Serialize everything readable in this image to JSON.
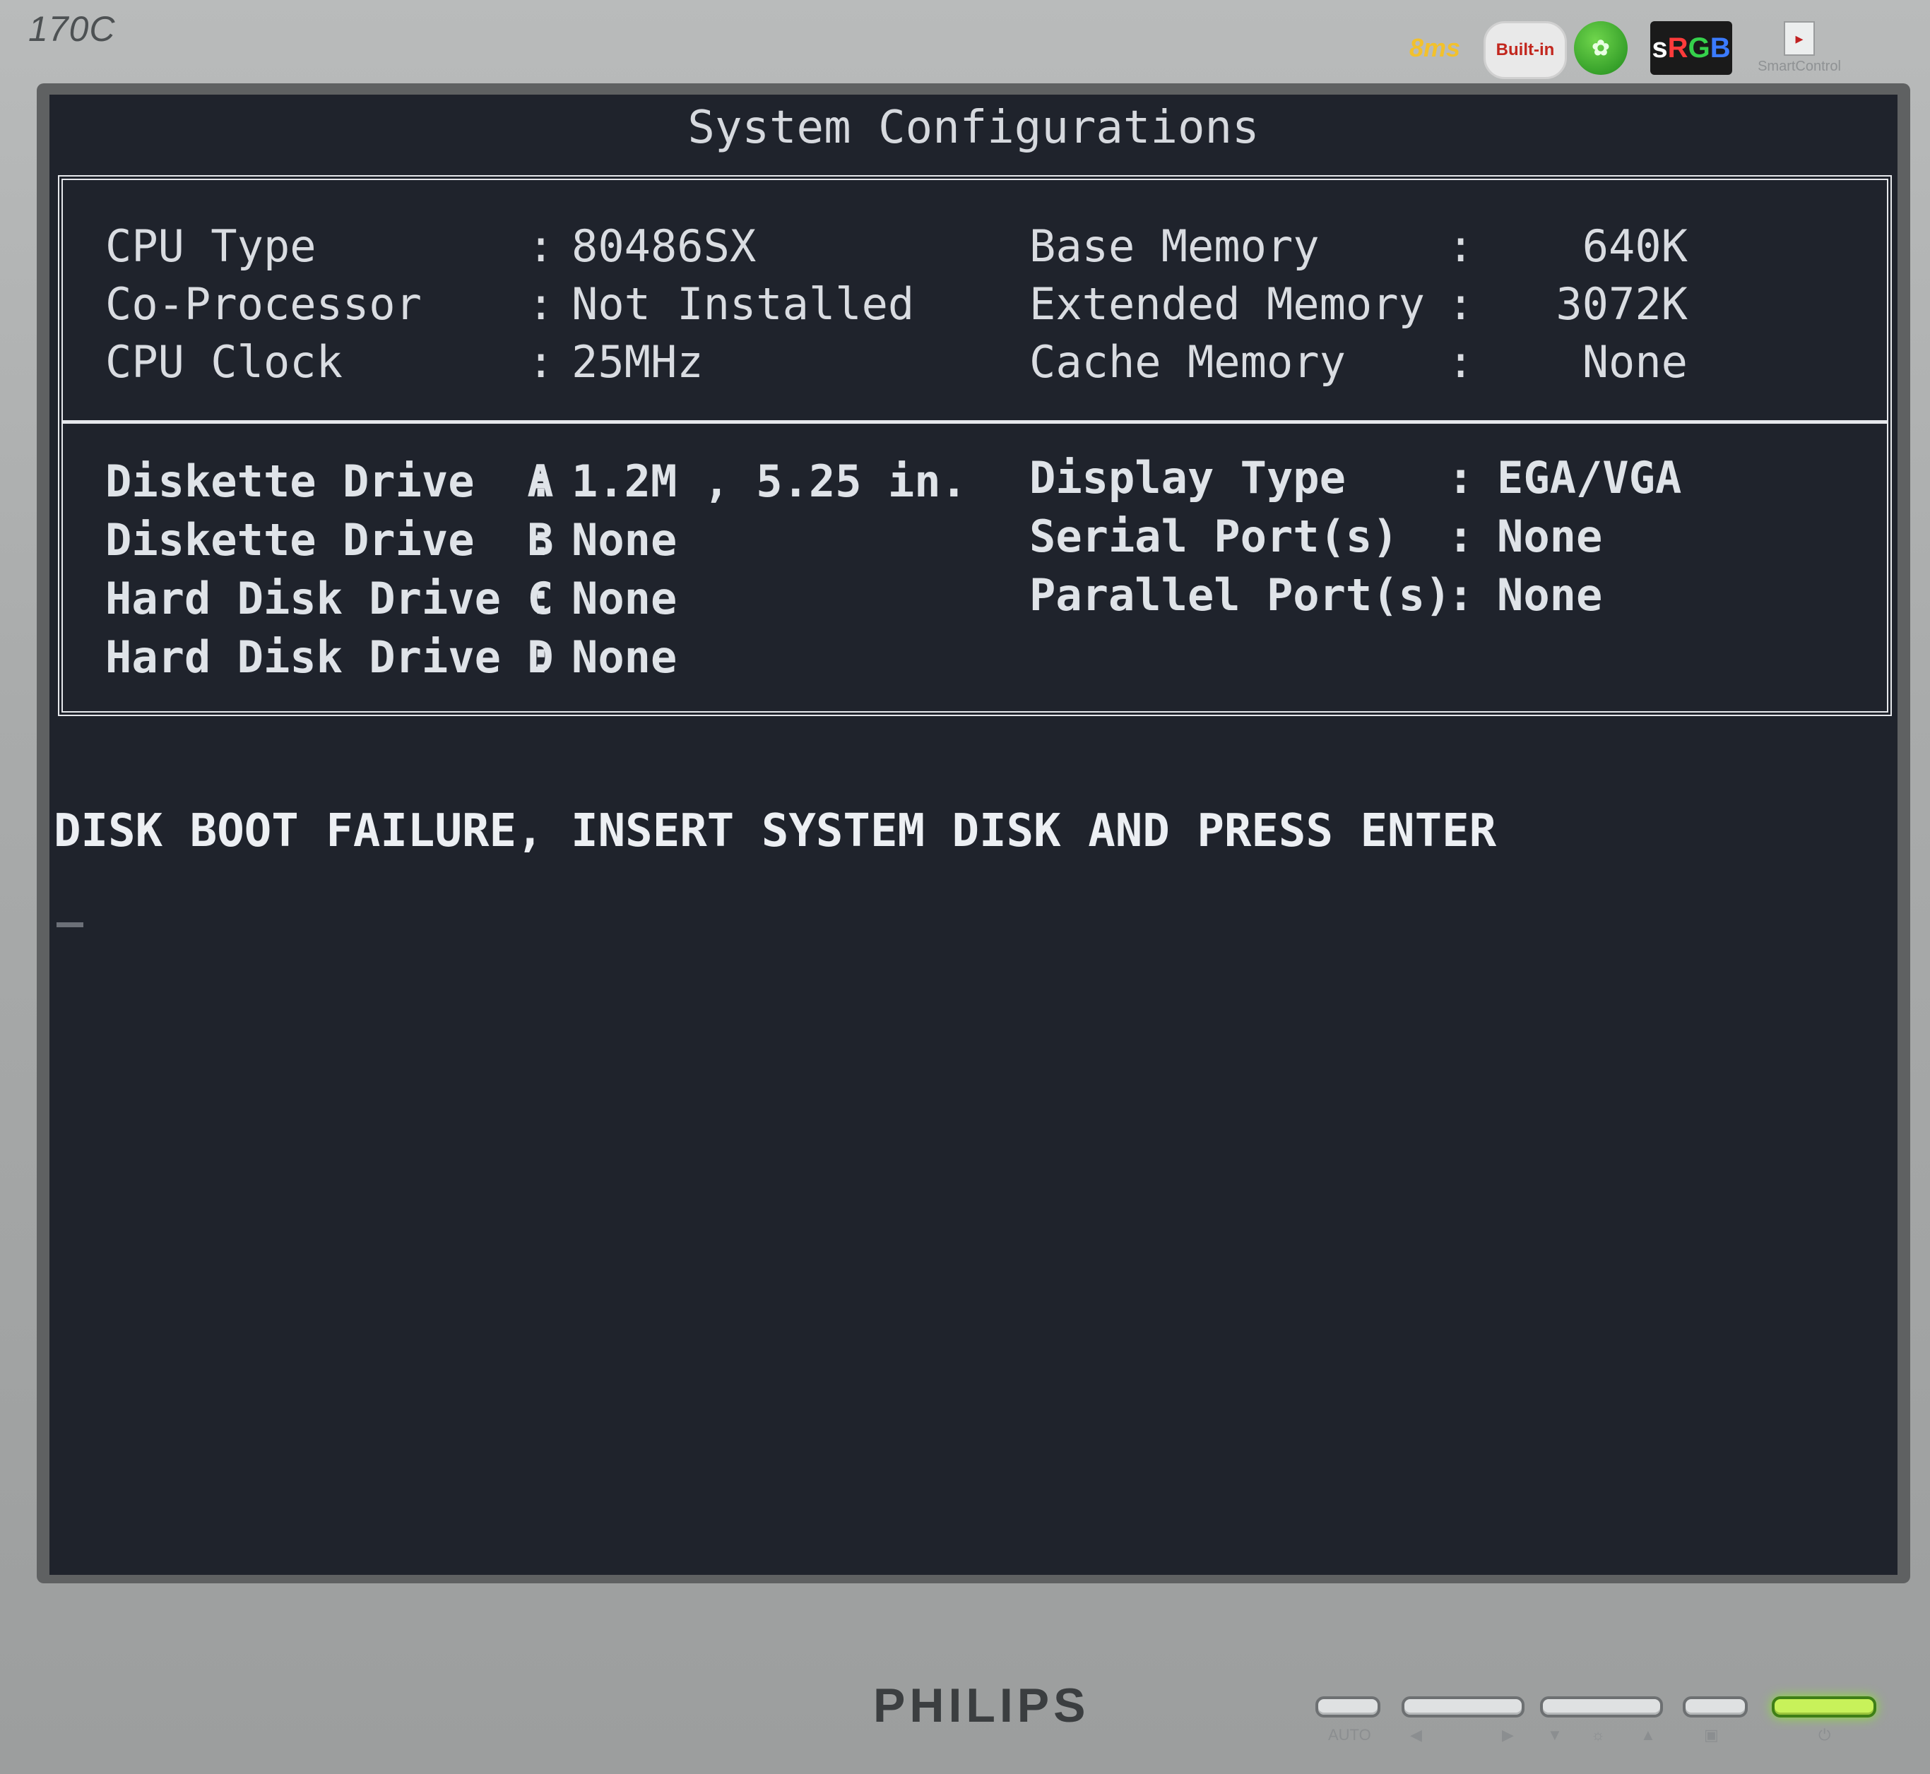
{
  "monitor": {
    "model": "170C",
    "brand": "PHILIPS",
    "badges": {
      "response": "8ms",
      "power": "Built-in",
      "leaf": "Lead-free",
      "srgb": "sRGB",
      "smart": "SmartControl"
    },
    "controls": {
      "auto_label": "AUTO"
    }
  },
  "bios": {
    "title": "System Configurations",
    "top_left": [
      {
        "label": "CPU Type",
        "value": "80486SX"
      },
      {
        "label": "Co-Processor",
        "value": "Not Installed"
      },
      {
        "label": "CPU Clock",
        "value": "25MHz"
      }
    ],
    "top_right": [
      {
        "label": "Base Memory",
        "value": "640K"
      },
      {
        "label": "Extended Memory",
        "value": "3072K"
      },
      {
        "label": "Cache Memory",
        "value": "None"
      }
    ],
    "bottom_left": [
      {
        "label": "Diskette Drive  A",
        "value": "1.2M , 5.25 in."
      },
      {
        "label": "Diskette Drive  B",
        "value": "None"
      },
      {
        "label": "Hard Disk Drive C",
        "value": "None"
      },
      {
        "label": "Hard Disk Drive D",
        "value": "None"
      }
    ],
    "bottom_right": [
      {
        "label": "Display Type",
        "value": "EGA/VGA"
      },
      {
        "label": "Serial Port(s)",
        "value": "None"
      },
      {
        "label": "Parallel Port(s)",
        "value": "None"
      }
    ],
    "separator": ":",
    "message": "DISK BOOT FAILURE, INSERT SYSTEM DISK AND PRESS ENTER"
  },
  "colors": {
    "screen_bg": "#1f232c",
    "text": "#dfe3e8",
    "bezel": "#a9abab",
    "power_led": "#c8f25a"
  }
}
